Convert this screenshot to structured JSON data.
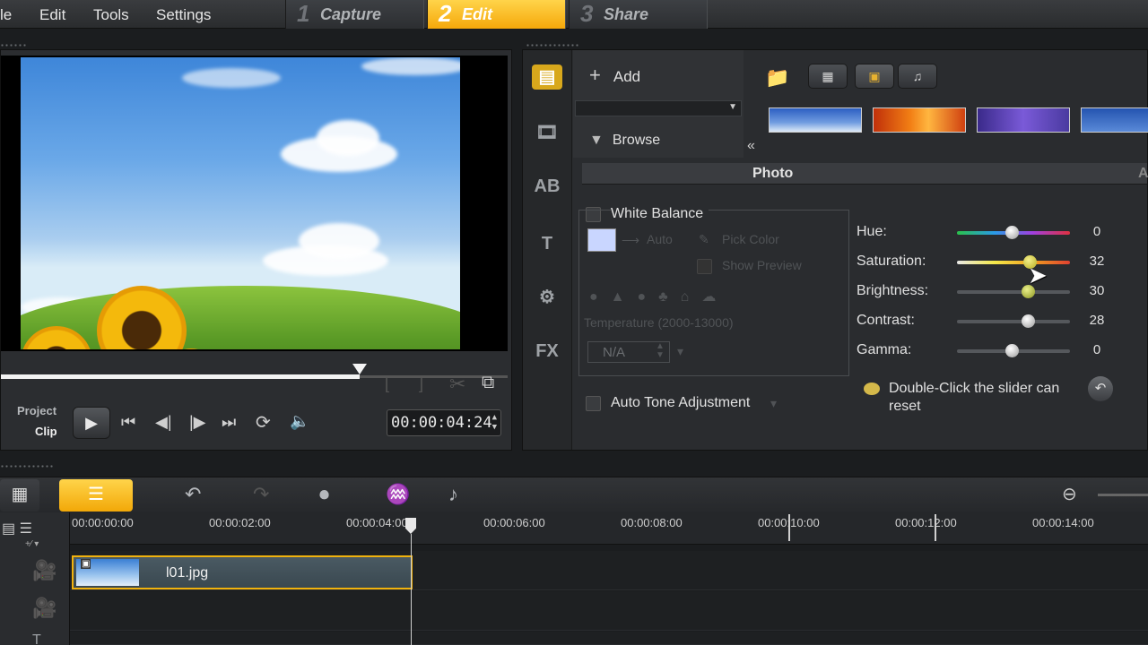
{
  "menu": {
    "items": [
      "le",
      "Edit",
      "Tools",
      "Settings"
    ]
  },
  "steps": [
    {
      "num": "1",
      "label": "Capture"
    },
    {
      "num": "2",
      "label": "Edit"
    },
    {
      "num": "3",
      "label": "Share"
    }
  ],
  "preview": {
    "mode_project": "Project",
    "mode_clip": "Clip",
    "timecode": "00:00:04:24",
    "scrub_progress": 0.71
  },
  "library": {
    "add_label": "Add",
    "browse_label": "Browse",
    "tab_photo": "Photo",
    "tab_attributes": "A"
  },
  "photo_options": {
    "white_balance": "White Balance",
    "auto": "Auto",
    "pick_color": "Pick Color",
    "show_preview": "Show Preview",
    "temperature": "Temperature (2000-13000)",
    "temperature_value": "N/A",
    "auto_tone": "Auto Tone Adjustment",
    "sliders": [
      {
        "name": "Hue:",
        "value": "0"
      },
      {
        "name": "Saturation:",
        "value": "32"
      },
      {
        "name": "Brightness:",
        "value": "30"
      },
      {
        "name": "Contrast:",
        "value": "28"
      },
      {
        "name": "Gamma:",
        "value": "0"
      }
    ],
    "hint": "Double-Click the slider can reset"
  },
  "timeline": {
    "ticks": [
      "00:00:00:00",
      "00:00:02:00",
      "00:00:04:00",
      "00:00:06:00",
      "00:00:08:00",
      "00:00:10:00",
      "00:00:12:00",
      "00:00:14:00"
    ],
    "clip_name": "l01.jpg"
  },
  "colors": {
    "accent": "#f5b20e",
    "panel": "#2a2c2f"
  }
}
